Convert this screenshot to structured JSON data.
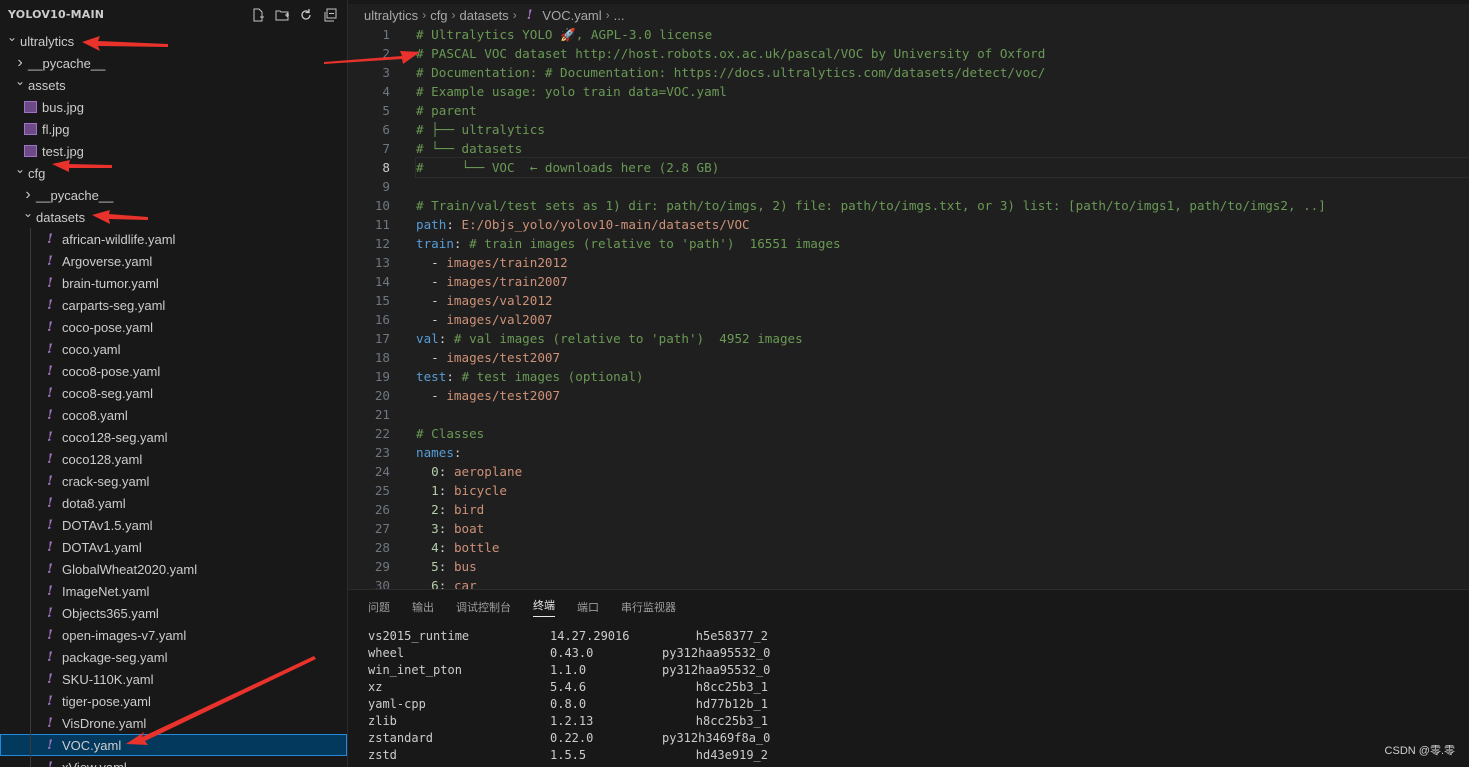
{
  "explorer": {
    "title": "YOLOV10-MAIN",
    "items": [
      {
        "label": "ultralytics",
        "level": 0,
        "type": "folder-open"
      },
      {
        "label": "__pycache__",
        "level": 1,
        "type": "folder-closed"
      },
      {
        "label": "assets",
        "level": 1,
        "type": "folder-open"
      },
      {
        "label": "bus.jpg",
        "level": 2,
        "type": "image"
      },
      {
        "label": "fl.jpg",
        "level": 2,
        "type": "image"
      },
      {
        "label": "test.jpg",
        "level": 2,
        "type": "image"
      },
      {
        "label": "cfg",
        "level": 1,
        "type": "folder-open"
      },
      {
        "label": "__pycache__",
        "level": 2,
        "type": "folder-closed"
      },
      {
        "label": "datasets",
        "level": 2,
        "type": "folder-open"
      },
      {
        "label": "african-wildlife.yaml",
        "level": 3,
        "type": "yaml"
      },
      {
        "label": "Argoverse.yaml",
        "level": 3,
        "type": "yaml"
      },
      {
        "label": "brain-tumor.yaml",
        "level": 3,
        "type": "yaml"
      },
      {
        "label": "carparts-seg.yaml",
        "level": 3,
        "type": "yaml"
      },
      {
        "label": "coco-pose.yaml",
        "level": 3,
        "type": "yaml"
      },
      {
        "label": "coco.yaml",
        "level": 3,
        "type": "yaml"
      },
      {
        "label": "coco8-pose.yaml",
        "level": 3,
        "type": "yaml"
      },
      {
        "label": "coco8-seg.yaml",
        "level": 3,
        "type": "yaml"
      },
      {
        "label": "coco8.yaml",
        "level": 3,
        "type": "yaml"
      },
      {
        "label": "coco128-seg.yaml",
        "level": 3,
        "type": "yaml"
      },
      {
        "label": "coco128.yaml",
        "level": 3,
        "type": "yaml"
      },
      {
        "label": "crack-seg.yaml",
        "level": 3,
        "type": "yaml"
      },
      {
        "label": "dota8.yaml",
        "level": 3,
        "type": "yaml"
      },
      {
        "label": "DOTAv1.5.yaml",
        "level": 3,
        "type": "yaml"
      },
      {
        "label": "DOTAv1.yaml",
        "level": 3,
        "type": "yaml"
      },
      {
        "label": "GlobalWheat2020.yaml",
        "level": 3,
        "type": "yaml"
      },
      {
        "label": "ImageNet.yaml",
        "level": 3,
        "type": "yaml"
      },
      {
        "label": "Objects365.yaml",
        "level": 3,
        "type": "yaml"
      },
      {
        "label": "open-images-v7.yaml",
        "level": 3,
        "type": "yaml"
      },
      {
        "label": "package-seg.yaml",
        "level": 3,
        "type": "yaml"
      },
      {
        "label": "SKU-110K.yaml",
        "level": 3,
        "type": "yaml"
      },
      {
        "label": "tiger-pose.yaml",
        "level": 3,
        "type": "yaml"
      },
      {
        "label": "VisDrone.yaml",
        "level": 3,
        "type": "yaml"
      },
      {
        "label": "VOC.yaml",
        "level": 3,
        "type": "yaml",
        "selected": true
      },
      {
        "label": "xView.yaml",
        "level": 3,
        "type": "yaml"
      }
    ]
  },
  "breadcrumb": [
    "ultralytics",
    "cfg",
    "datasets",
    "VOC.yaml",
    "..."
  ],
  "code_lines": [
    [
      [
        "# Ultralytics YOLO 🚀, AGPL-3.0 license",
        "c"
      ]
    ],
    [
      [
        "# PASCAL VOC dataset http://host.robots.ox.ac.uk/pascal/VOC by University of Oxford",
        "c"
      ]
    ],
    [
      [
        "# Documentation: # Documentation: https://docs.ultralytics.com/datasets/detect/voc/",
        "c"
      ]
    ],
    [
      [
        "# Example usage: yolo train data=VOC.yaml",
        "c"
      ]
    ],
    [
      [
        "# parent",
        "c"
      ]
    ],
    [
      [
        "# ├── ultralytics",
        "c"
      ]
    ],
    [
      [
        "# └── datasets",
        "c"
      ]
    ],
    [
      [
        "#     └── VOC  ← downloads here (2.8 GB)",
        "c"
      ]
    ],
    [],
    [
      [
        "# Train/val/test sets as 1) dir: path/to/imgs, 2) file: path/to/imgs.txt, or 3) list: [path/to/imgs1, path/to/imgs2, ..]",
        "c"
      ]
    ],
    [
      [
        "path",
        "k"
      ],
      [
        ": ",
        "t"
      ],
      [
        "E:/Objs_yolo/yolov10-main/datasets/VOC",
        "v"
      ]
    ],
    [
      [
        "train",
        "k"
      ],
      [
        ": ",
        "t"
      ],
      [
        "# train images (relative to 'path')  16551 images",
        "c"
      ]
    ],
    [
      [
        "  - ",
        "t"
      ],
      [
        "images/train2012",
        "v"
      ]
    ],
    [
      [
        "  - ",
        "t"
      ],
      [
        "images/train2007",
        "v"
      ]
    ],
    [
      [
        "  - ",
        "t"
      ],
      [
        "images/val2012",
        "v"
      ]
    ],
    [
      [
        "  - ",
        "t"
      ],
      [
        "images/val2007",
        "v"
      ]
    ],
    [
      [
        "val",
        "k"
      ],
      [
        ": ",
        "t"
      ],
      [
        "# val images (relative to 'path')  4952 images",
        "c"
      ]
    ],
    [
      [
        "  - ",
        "t"
      ],
      [
        "images/test2007",
        "v"
      ]
    ],
    [
      [
        "test",
        "k"
      ],
      [
        ": ",
        "t"
      ],
      [
        "# test images (optional)",
        "c"
      ]
    ],
    [
      [
        "  - ",
        "t"
      ],
      [
        "images/test2007",
        "v"
      ]
    ],
    [],
    [
      [
        "# Classes",
        "c"
      ]
    ],
    [
      [
        "names",
        "k"
      ],
      [
        ":",
        "t"
      ]
    ],
    [
      [
        "  ",
        "t"
      ],
      [
        "0",
        "n"
      ],
      [
        ": ",
        "t"
      ],
      [
        "aeroplane",
        "v"
      ]
    ],
    [
      [
        "  ",
        "t"
      ],
      [
        "1",
        "n"
      ],
      [
        ": ",
        "t"
      ],
      [
        "bicycle",
        "v"
      ]
    ],
    [
      [
        "  ",
        "t"
      ],
      [
        "2",
        "n"
      ],
      [
        ": ",
        "t"
      ],
      [
        "bird",
        "v"
      ]
    ],
    [
      [
        "  ",
        "t"
      ],
      [
        "3",
        "n"
      ],
      [
        ": ",
        "t"
      ],
      [
        "boat",
        "v"
      ]
    ],
    [
      [
        "  ",
        "t"
      ],
      [
        "4",
        "n"
      ],
      [
        ": ",
        "t"
      ],
      [
        "bottle",
        "v"
      ]
    ],
    [
      [
        "  ",
        "t"
      ],
      [
        "5",
        "n"
      ],
      [
        ": ",
        "t"
      ],
      [
        "bus",
        "v"
      ]
    ],
    [
      [
        "  ",
        "t"
      ],
      [
        "6",
        "n"
      ],
      [
        ": ",
        "t"
      ],
      [
        "car",
        "v"
      ]
    ]
  ],
  "current_line": 8,
  "panel_tabs": [
    {
      "label": "问题",
      "active": false
    },
    {
      "label": "输出",
      "active": false
    },
    {
      "label": "调试控制台",
      "active": false
    },
    {
      "label": "终端",
      "active": true
    },
    {
      "label": "端口",
      "active": false
    },
    {
      "label": "串行监视器",
      "active": false
    }
  ],
  "terminal_rows": [
    [
      "vs2015_runtime",
      "14.27.29016",
      "h5e58377_2"
    ],
    [
      "wheel",
      "0.43.0",
      "py312haa95532_0"
    ],
    [
      "win_inet_pton",
      "1.1.0",
      "py312haa95532_0"
    ],
    [
      "xz",
      "5.4.6",
      "h8cc25b3_1"
    ],
    [
      "yaml-cpp",
      "0.8.0",
      "hd77b12b_1"
    ],
    [
      "zlib",
      "1.2.13",
      "h8cc25b3_1"
    ],
    [
      "zstandard",
      "0.22.0",
      "py312h3469f8a_0"
    ],
    [
      "zstd",
      "1.5.5",
      "hd43e919_2"
    ]
  ],
  "watermark": "CSDN @零.零",
  "colors": {
    "accent": "#2488db",
    "arrow": "#e8322b",
    "comment": "#6a9955",
    "key": "#569cd6",
    "string": "#ce9178"
  }
}
